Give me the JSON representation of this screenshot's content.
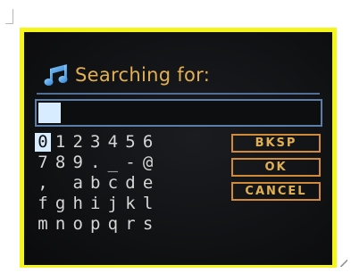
{
  "dialog": {
    "title": "Searching for:",
    "title_icon": "music-note-icon",
    "search_value": "",
    "accent_color": "#e2b052",
    "field_border_color": "#5b7fa8",
    "frame_color": "#f5f51a"
  },
  "keyboard": {
    "rows": [
      [
        "0",
        "1",
        "2",
        "3",
        "4",
        "5",
        "6"
      ],
      [
        "7",
        "8",
        "9",
        ".",
        "_",
        "-",
        "@"
      ],
      [
        ",",
        " ",
        "a",
        "b",
        "c",
        "d",
        "e"
      ],
      [
        "f",
        "g",
        "h",
        "i",
        "j",
        "k",
        "l"
      ],
      [
        "m",
        "n",
        "o",
        "p",
        "q",
        "r",
        "s"
      ]
    ],
    "selected_key": "0"
  },
  "function_keys": {
    "backspace": "BKSP",
    "ok": "OK",
    "cancel": "CANCEL"
  }
}
